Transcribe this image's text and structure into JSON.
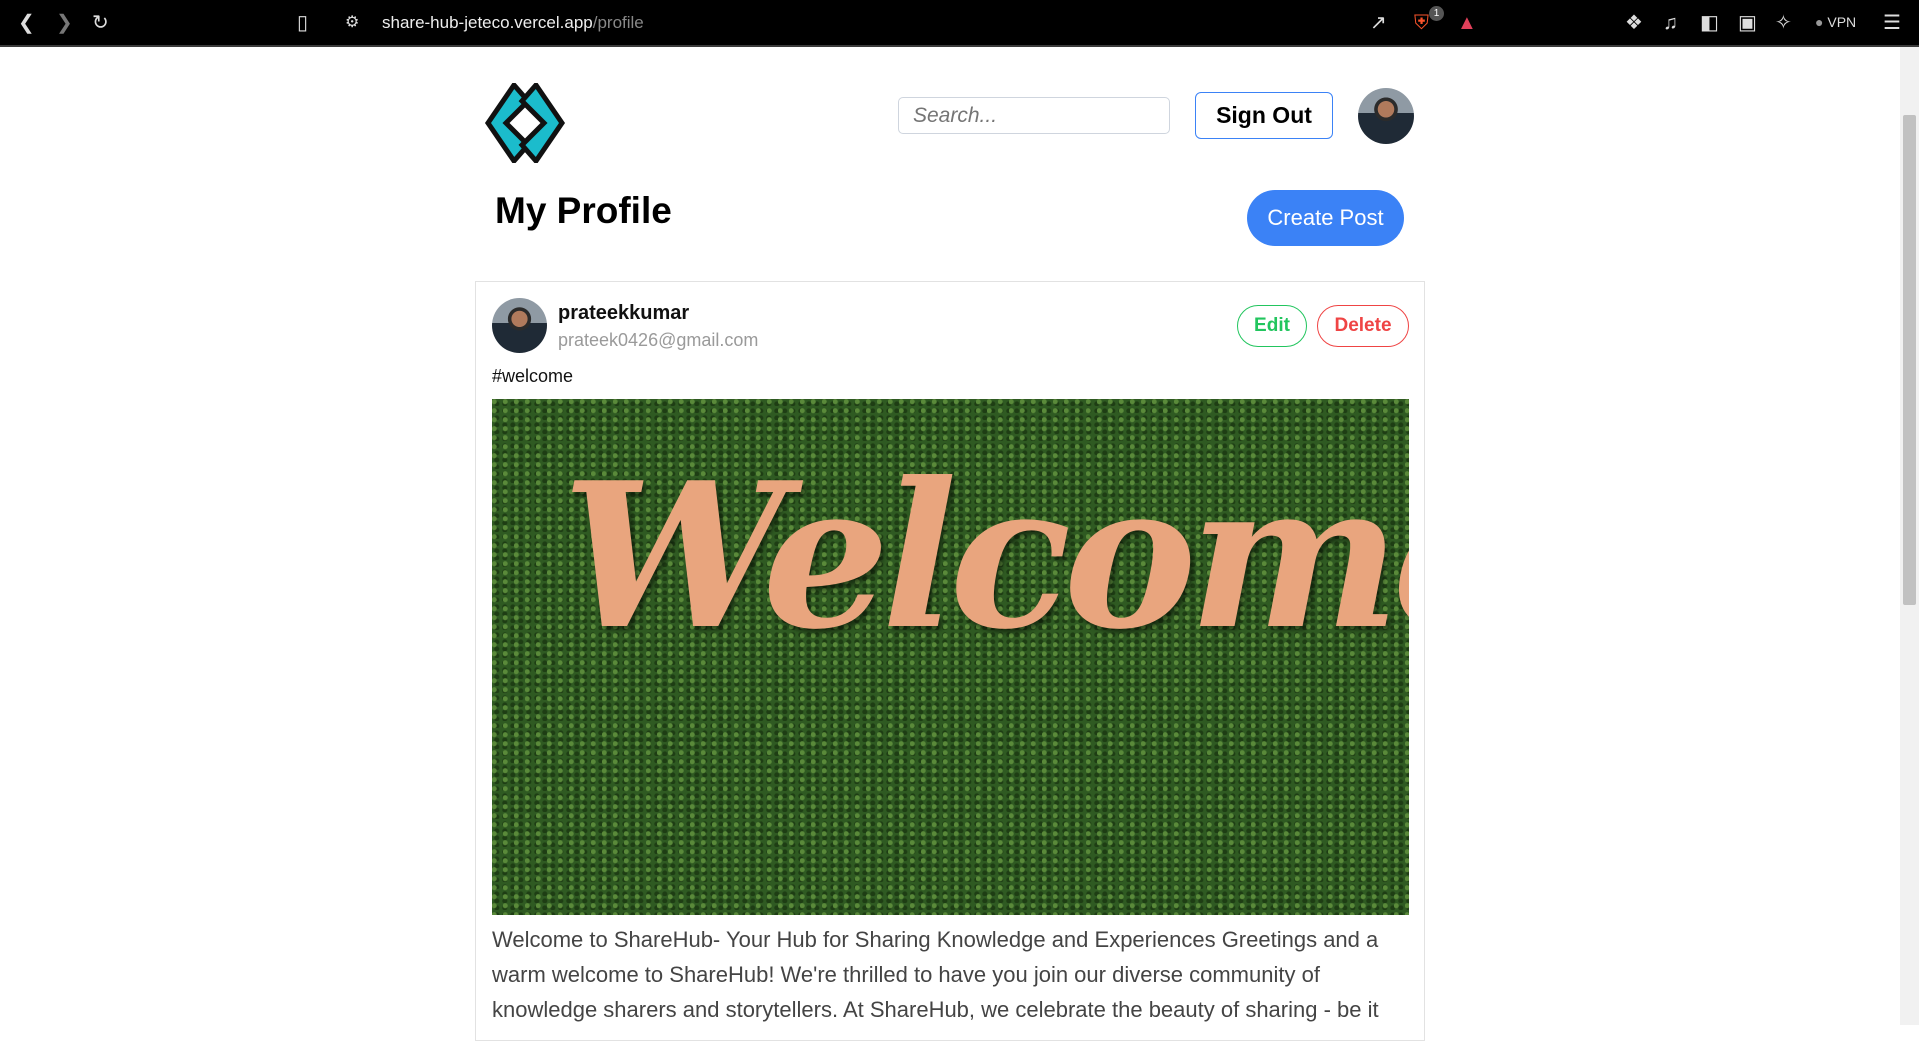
{
  "browser": {
    "url_host": "share-hub-jeteco.vercel.app",
    "url_path": "/profile",
    "shields_count": "1",
    "vpn_label": "VPN"
  },
  "header": {
    "search_placeholder": "Search...",
    "sign_out": "Sign Out"
  },
  "page": {
    "title": "My Profile",
    "create_post": "Create Post"
  },
  "post": {
    "username": "prateekkumar",
    "email": "prateek0426@gmail.com",
    "edit": "Edit",
    "delete": "Delete",
    "tag": "#welcome",
    "image_text": "Welcome",
    "body": "Welcome to ShareHub- Your Hub for Sharing Knowledge and Experiences Greetings and a warm welcome to ShareHub! We're thrilled to have you join our diverse community of knowledge sharers and storytellers. At ShareHub, we celebrate the beauty of sharing - be it"
  }
}
